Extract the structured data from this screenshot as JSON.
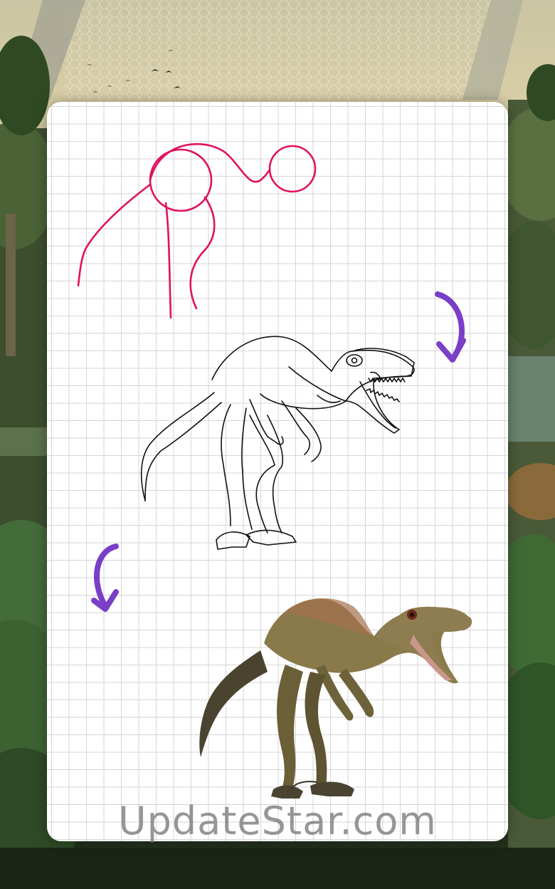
{
  "watermark": {
    "text": "UpdateStar.com"
  },
  "steps": [
    {
      "name": "sketch-step",
      "stroke_color": "#e0115f"
    },
    {
      "name": "line-art-step",
      "stroke_color": "#111111"
    },
    {
      "name": "colored-step",
      "fill_color": "#8a7a4a"
    }
  ],
  "arrows": {
    "color": "#7a3ec8",
    "icons": [
      "curved-arrow-down-icon",
      "curved-arrow-down-icon"
    ]
  },
  "colors": {
    "grid_line": "#d6d6d6",
    "card_background": "#ffffff",
    "jungle_dark": "#26331f",
    "sky": "#d9cfa7"
  }
}
